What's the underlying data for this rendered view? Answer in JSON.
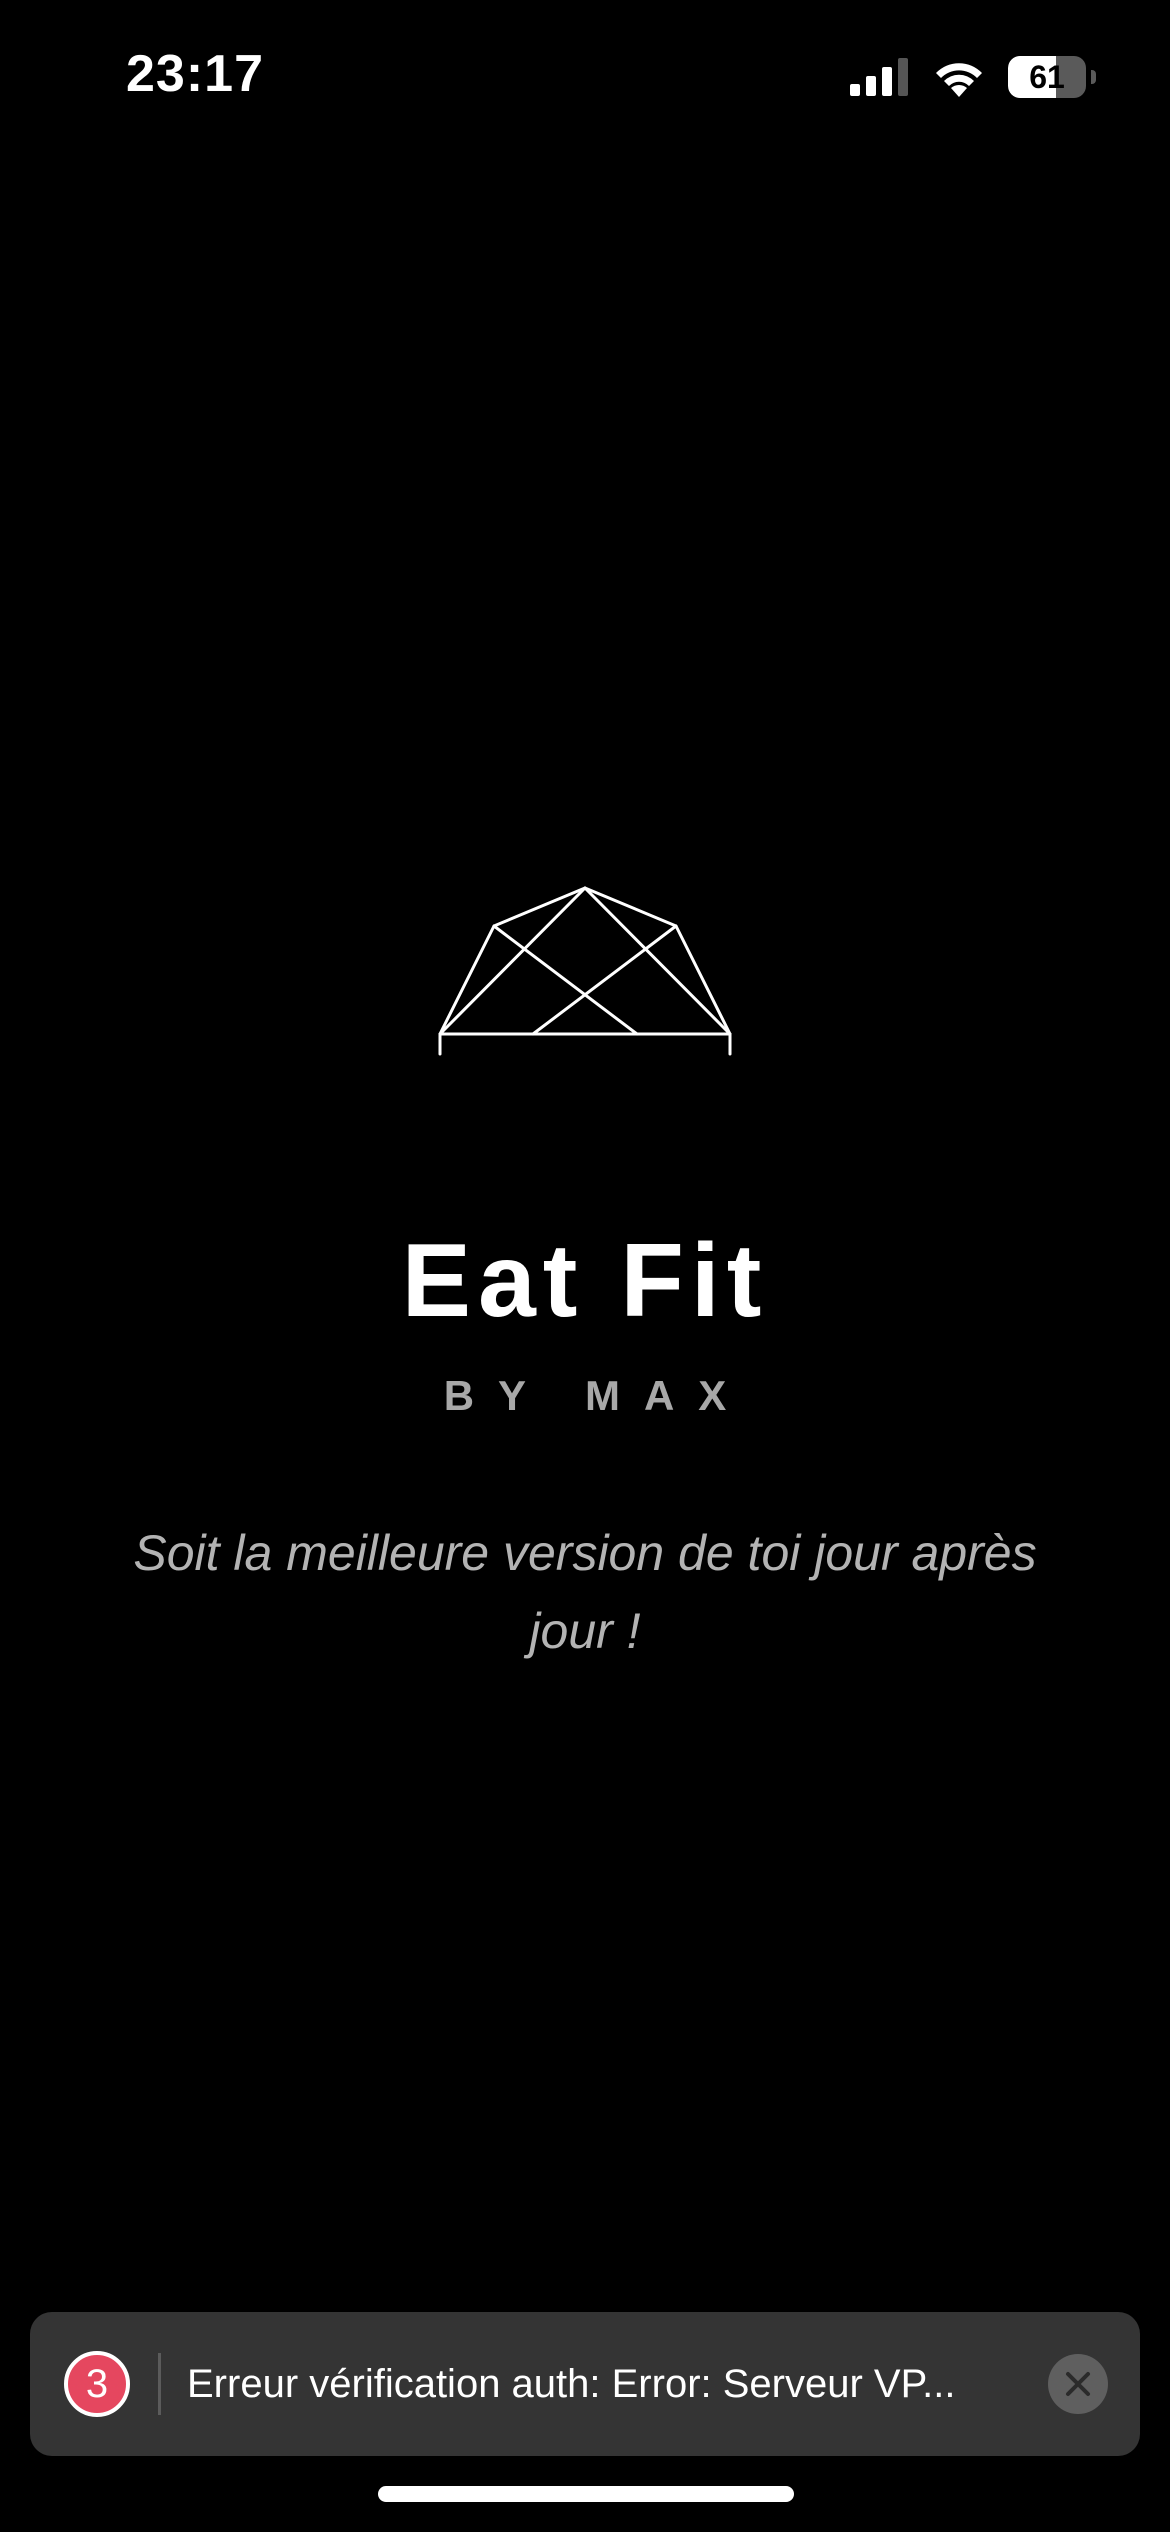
{
  "status_bar": {
    "time": "23:17",
    "battery_level": "61",
    "icons": [
      "cellular-signal-icon",
      "wifi-icon",
      "battery-icon"
    ]
  },
  "splash": {
    "logo_icon": "geometric-dome-logo-icon",
    "title": "Eat Fit",
    "subtitle": "BY MAX",
    "tagline": "Soit la meilleure version de toi jour après jour !"
  },
  "toast": {
    "count": "3",
    "message": "Erreur vérification auth: Error: Serveur VP...",
    "close_icon": "close-icon",
    "accent_color": "#e5475f"
  },
  "colors": {
    "background": "#000000",
    "title": "#ffffff",
    "subtitle": "#a8a8a8",
    "toast_background": "#343434"
  }
}
